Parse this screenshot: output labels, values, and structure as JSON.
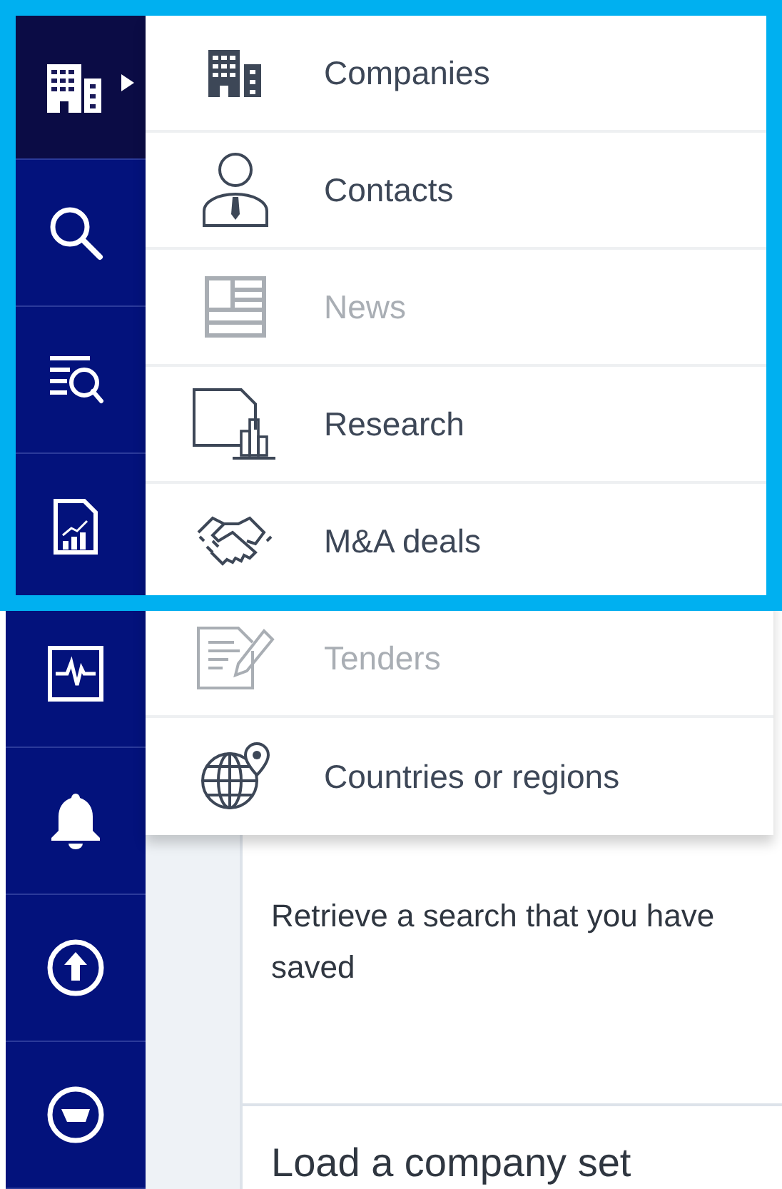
{
  "sidebar": {
    "items": [
      {
        "selected": true,
        "expanded": true
      },
      {
        "selected": false
      },
      {
        "selected": false
      },
      {
        "selected": false
      },
      {
        "selected": false
      },
      {
        "selected": false
      },
      {
        "selected": false
      },
      {
        "selected": false
      }
    ]
  },
  "menu": {
    "items": [
      {
        "label": "Companies",
        "disabled": false
      },
      {
        "label": "Contacts",
        "disabled": false
      },
      {
        "label": "News",
        "disabled": true
      },
      {
        "label": "Research",
        "disabled": false
      },
      {
        "label": "M&A deals",
        "disabled": false
      },
      {
        "label": "Tenders",
        "disabled": true
      },
      {
        "label": "Countries or regions",
        "disabled": false
      }
    ]
  },
  "cards": [
    {
      "description": "Retrieve a search that you have saved"
    },
    {
      "title": "Load a company set"
    }
  ]
}
